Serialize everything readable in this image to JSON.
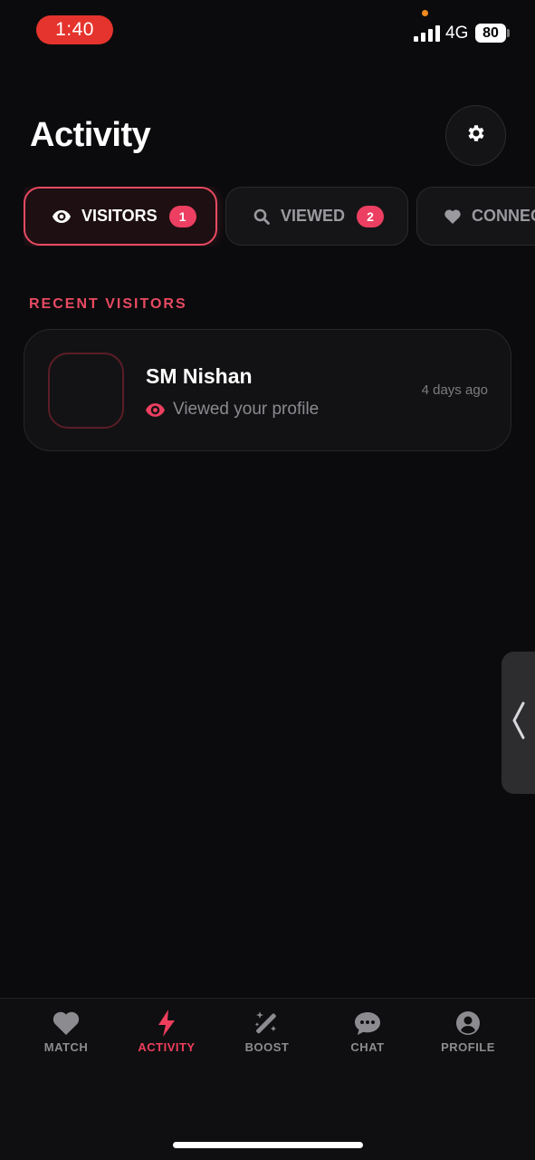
{
  "status_bar": {
    "time": "1:40",
    "network": "4G",
    "battery": "80"
  },
  "header": {
    "title": "Activity"
  },
  "tabs": [
    {
      "label": "VISITORS",
      "badge": "1",
      "icon": "eye-icon",
      "active": true
    },
    {
      "label": "VIEWED",
      "badge": "2",
      "icon": "search-icon",
      "active": false
    },
    {
      "label": "CONNECTIONS",
      "visible_label": "CONNEC",
      "icon": "heart-icon",
      "active": false
    }
  ],
  "section": {
    "label": "RECENT VISITORS"
  },
  "visitors": [
    {
      "name": "SM Nishan",
      "subtitle": "Viewed your profile",
      "time": "4 days ago"
    }
  ],
  "bottom_nav": [
    {
      "label": "MATCH",
      "icon": "heart-icon",
      "active": false
    },
    {
      "label": "ACTIVITY",
      "icon": "bolt-icon",
      "active": true
    },
    {
      "label": "BOOST",
      "icon": "magic-wand-icon",
      "active": false
    },
    {
      "label": "CHAT",
      "icon": "chat-bubble-icon",
      "active": false
    },
    {
      "label": "PROFILE",
      "icon": "user-circle-icon",
      "active": false
    }
  ],
  "colors": {
    "accent": "#ec3f61",
    "background": "#0b0b0d",
    "time_pill": "#e5342d"
  }
}
